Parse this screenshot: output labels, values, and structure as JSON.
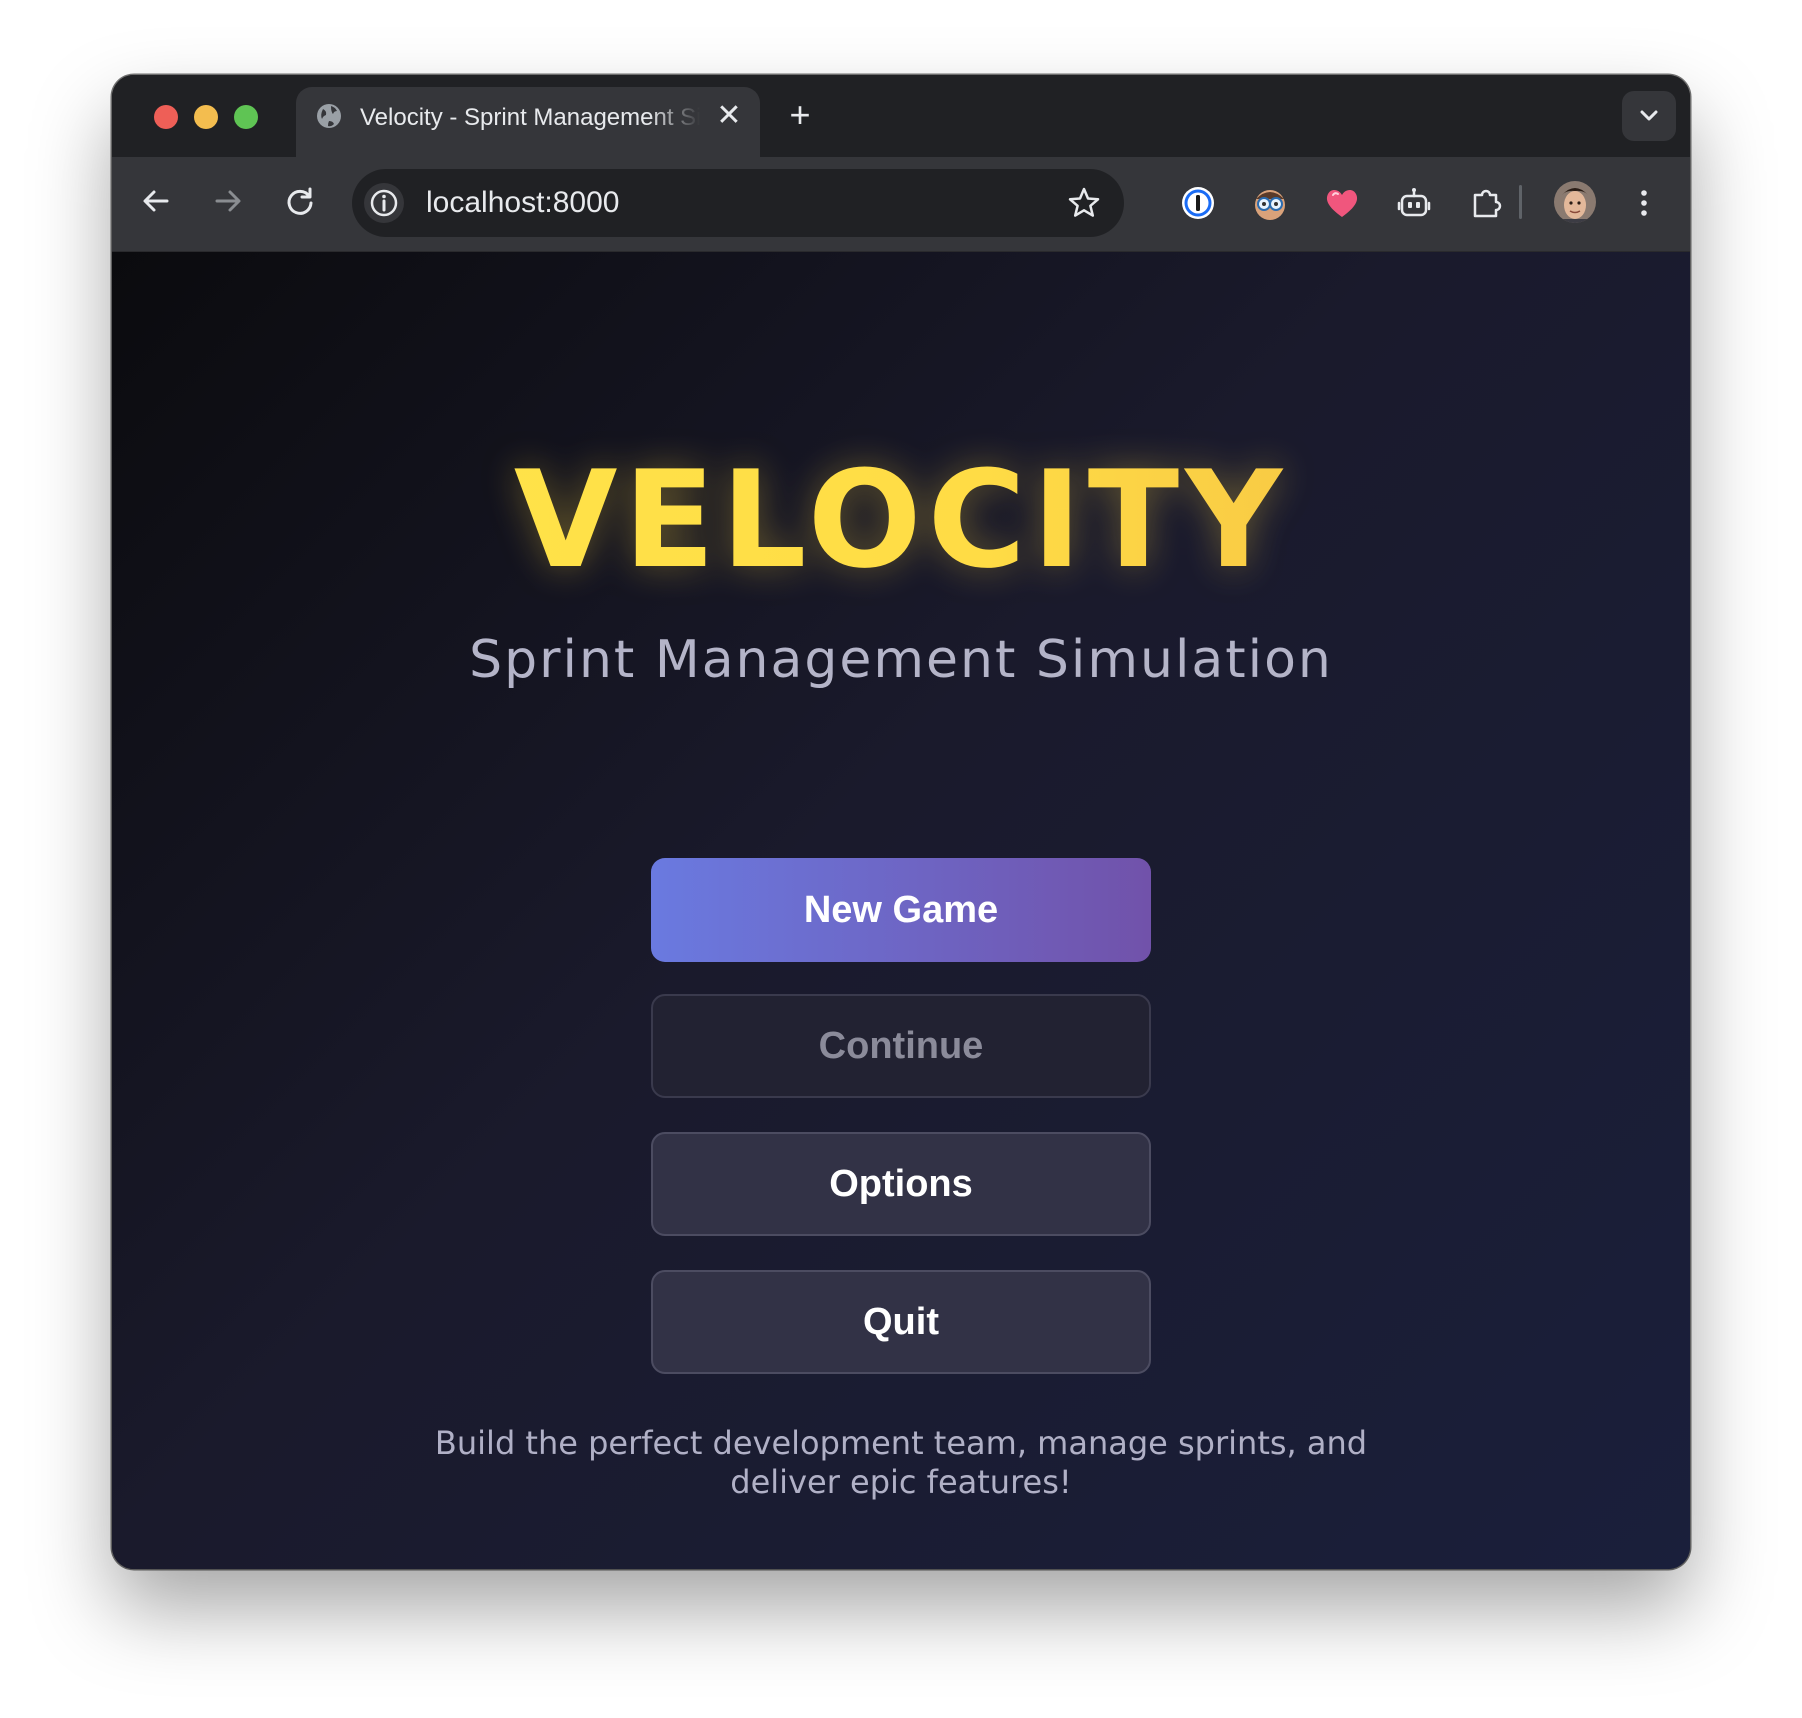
{
  "browser": {
    "tab_title": "Velocity - Sprint Management Simulation",
    "close_glyph": "✕",
    "newtab_glyph": "+",
    "url": "localhost:8000",
    "icons": [
      "globe-icon",
      "back-arrow-icon",
      "forward-arrow-icon",
      "reload-icon",
      "site-info-icon",
      "bookmark-star-icon",
      "password-manager-icon",
      "glasses-extension-icon",
      "heart-extension-icon",
      "robot-extension-icon",
      "extensions-puzzle-icon",
      "profile-avatar",
      "more-menu-icon"
    ],
    "colors": {
      "traffic_red": "#ee5f57",
      "traffic_yellow": "#f3bd4f",
      "traffic_green": "#5fc454",
      "tabstrip": "#202124",
      "toolbar": "#35363a"
    }
  },
  "page": {
    "title": "VELOCITY",
    "subtitle": "Sprint Management Simulation",
    "buttons": {
      "new_game": "New Game",
      "continue": "Continue",
      "options": "Options",
      "quit": "Quit"
    },
    "tagline": "Build the perfect development team, manage sprints, and deliver epic features!",
    "colors": {
      "title_gradient_start": "#ffe74c",
      "title_gradient_end": "#f0b544",
      "primary_gradient_start": "#6a7ae0",
      "primary_gradient_end": "#7152aa",
      "background": "#1a1a2c"
    }
  }
}
